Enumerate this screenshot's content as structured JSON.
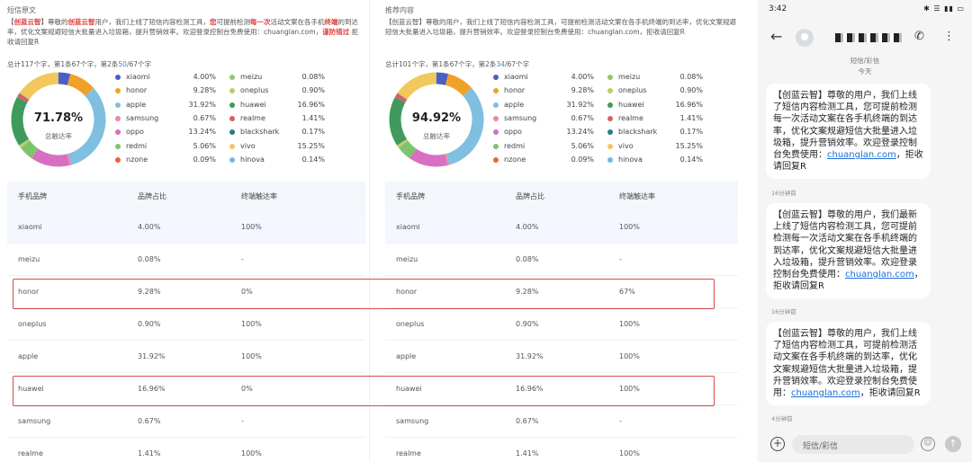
{
  "left": {
    "title": "短信原文",
    "desc_parts": [
      {
        "t": "【",
        "s": ""
      },
      {
        "t": "创蓝云智",
        "s": "hl-blue"
      },
      {
        "t": "】尊敬的",
        "s": ""
      },
      {
        "t": "创蓝云智",
        "s": "hl-red"
      },
      {
        "t": "用户，我们上线了短信内容检测工具，",
        "s": ""
      },
      {
        "t": "您",
        "s": "hl-red"
      },
      {
        "t": "可提前检测",
        "s": ""
      },
      {
        "t": "每一次",
        "s": "hl-red"
      },
      {
        "t": "活动文案在各手机",
        "s": ""
      },
      {
        "t": "终端",
        "s": "hl-red"
      },
      {
        "t": "的到达率，优化文案规避短信大批量进入垃圾箱，提升营销效率。欢迎登录控制台免费使用：chuanglan.com，",
        "s": ""
      },
      {
        "t": "谨防错过",
        "s": "hl-red"
      },
      {
        "t": " 拒收请回复R",
        "s": ""
      }
    ],
    "totals": {
      "a": "总计117个字，第1条67个字，第2条",
      "b": "50",
      "c": "/67个字"
    },
    "rate": "71.78%",
    "rate_label": "总触达率",
    "legend": [
      {
        "name": "xiaomi",
        "value": "4.00%",
        "color": "#4a5fc1"
      },
      {
        "name": "honor",
        "value": "9.28%",
        "color": "#f0a12a"
      },
      {
        "name": "apple",
        "value": "31.92%",
        "color": "#7fbfe0"
      },
      {
        "name": "samsung",
        "value": "0.67%",
        "color": "#e88b9a"
      },
      {
        "name": "oppo",
        "value": "13.24%",
        "color": "#d86fc3"
      },
      {
        "name": "redmi",
        "value": "5.06%",
        "color": "#7dc46a"
      },
      {
        "name": "nzone",
        "value": "0.09%",
        "color": "#e8643a"
      },
      {
        "name": "meizu",
        "value": "0.08%",
        "color": "#98c46f"
      },
      {
        "name": "oneplus",
        "value": "0.90%",
        "color": "#b5cf6b"
      },
      {
        "name": "huawei",
        "value": "16.96%",
        "color": "#3f9a5c"
      },
      {
        "name": "realme",
        "value": "1.41%",
        "color": "#d85f6a"
      },
      {
        "name": "blackshark",
        "value": "0.17%",
        "color": "#2f7b7f"
      },
      {
        "name": "vivo",
        "value": "15.25%",
        "color": "#f2c75c"
      },
      {
        "name": "hinova",
        "value": "0.14%",
        "color": "#6fb8e6"
      }
    ],
    "headers": [
      "手机品牌",
      "品牌占比",
      "终端触达率"
    ],
    "rows": [
      [
        "xiaomi",
        "4.00%",
        "100%"
      ],
      [
        "meizu",
        "0.08%",
        "-"
      ],
      [
        "honor",
        "9.28%",
        "0%"
      ],
      [
        "oneplus",
        "0.90%",
        "100%"
      ],
      [
        "apple",
        "31.92%",
        "100%"
      ],
      [
        "huawei",
        "16.96%",
        "0%"
      ],
      [
        "samsung",
        "0.67%",
        "-"
      ],
      [
        "realme",
        "1.41%",
        "100%"
      ]
    ]
  },
  "right": {
    "title": "推荐内容",
    "desc": "【创蓝云智】尊敬的用户，我们上线了短信内容检测工具，可提前检测活动文案在各手机终端的到达率，优化文案规避短信大批量进入垃圾箱，提升营销效率。欢迎登录控制台免费使用：chuanglan.com，拒收请回复R",
    "totals": {
      "a": "总计101个字，第1条67个字，第2条",
      "b": "34",
      "c": "/67个字"
    },
    "rate": "94.92%",
    "rate_label": "总触达率",
    "legend": [
      {
        "name": "xiaomi",
        "value": "4.00%",
        "color": "#4a5fc1"
      },
      {
        "name": "honor",
        "value": "9.28%",
        "color": "#f0a12a"
      },
      {
        "name": "apple",
        "value": "31.92%",
        "color": "#7fbfe0"
      },
      {
        "name": "samsung",
        "value": "0.67%",
        "color": "#e88b9a"
      },
      {
        "name": "oppo",
        "value": "13.24%",
        "color": "#d86fc3"
      },
      {
        "name": "redmi",
        "value": "5.06%",
        "color": "#7dc46a"
      },
      {
        "name": "nzone",
        "value": "0.09%",
        "color": "#e8643a"
      },
      {
        "name": "meizu",
        "value": "0.08%",
        "color": "#98c46f"
      },
      {
        "name": "oneplus",
        "value": "0.90%",
        "color": "#b5cf6b"
      },
      {
        "name": "huawei",
        "value": "16.96%",
        "color": "#3f9a5c"
      },
      {
        "name": "realme",
        "value": "1.41%",
        "color": "#d85f6a"
      },
      {
        "name": "blackshark",
        "value": "0.17%",
        "color": "#2f7b7f"
      },
      {
        "name": "vivo",
        "value": "15.25%",
        "color": "#f2c75c"
      },
      {
        "name": "hinova",
        "value": "0.14%",
        "color": "#6fb8e6"
      }
    ],
    "headers": [
      "手机品牌",
      "品牌占比",
      "终端触达率"
    ],
    "rows": [
      [
        "xiaomi",
        "4.00%",
        "100%"
      ],
      [
        "meizu",
        "0.08%",
        "-"
      ],
      [
        "honor",
        "9.28%",
        "67%"
      ],
      [
        "oneplus",
        "0.90%",
        "100%"
      ],
      [
        "apple",
        "31.92%",
        "100%"
      ],
      [
        "huawei",
        "16.96%",
        "100%"
      ],
      [
        "samsung",
        "0.67%",
        "-"
      ],
      [
        "realme",
        "1.41%",
        "100%"
      ]
    ]
  },
  "phone": {
    "time": "3:42",
    "status_icons": "✱ ☰ ▮▮ ▭",
    "sender": "短信/彩信",
    "today": "今天",
    "messages": [
      {
        "text": "【创蓝云智】尊敬的用户，我们上线了短信内容检测工具，您可提前检测每一次活动文案在各手机终端的到达率，优化文案规避短信大批量进入垃圾箱，提升营销效率。欢迎登录控制台免费使用：",
        "link": "chuanglan.com",
        "tail": "，拒收请回复R",
        "time": "16分钟前"
      },
      {
        "text": "【创蓝云智】尊敬的用户，我们最新上线了短信内容检测工具，您可提前检测每一次活动文案在各手机终端的到达率，优化文案规避短信大批量进入垃圾箱，提升营销效率。欢迎登录控制台免费使用：",
        "link": "chuanglan.com",
        "tail": "，拒收请回复R",
        "time": "16分钟前"
      },
      {
        "text": "【创蓝云智】尊敬的用户，我们上线了短信内容检测工具，可提前检测活动文案在各手机终端的到达率，优化文案规避短信大批量进入垃圾箱，提升营销效率。欢迎登录控制台免费使用：",
        "link": "chuanglan.com",
        "tail": "，拒收请回复R",
        "time": "4分钟前"
      }
    ],
    "composer_placeholder": "短信/彩信"
  },
  "chart_data": [
    {
      "type": "pie",
      "categories": [
        "xiaomi",
        "honor",
        "apple",
        "samsung",
        "oppo",
        "redmi",
        "nzone",
        "meizu",
        "oneplus",
        "huawei",
        "realme",
        "blackshark",
        "vivo",
        "hinova"
      ],
      "values": [
        4.0,
        9.28,
        31.92,
        0.67,
        13.24,
        5.06,
        0.09,
        0.08,
        0.9,
        16.96,
        1.41,
        0.17,
        15.25,
        0.14
      ],
      "center_label": "71.78%",
      "subtitle": "总触达率"
    },
    {
      "type": "pie",
      "categories": [
        "xiaomi",
        "honor",
        "apple",
        "samsung",
        "oppo",
        "redmi",
        "nzone",
        "meizu",
        "oneplus",
        "huawei",
        "realme",
        "blackshark",
        "vivo",
        "hinova"
      ],
      "values": [
        4.0,
        9.28,
        31.92,
        0.67,
        13.24,
        5.06,
        0.09,
        0.08,
        0.9,
        16.96,
        1.41,
        0.17,
        15.25,
        0.14
      ],
      "center_label": "94.92%",
      "subtitle": "总触达率"
    }
  ]
}
